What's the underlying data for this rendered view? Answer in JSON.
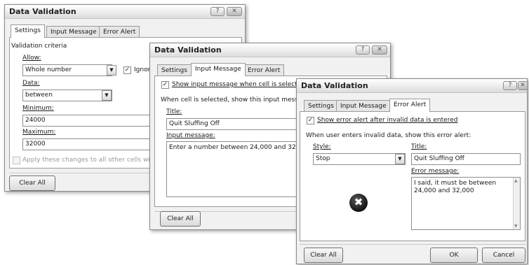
{
  "dialog1": {
    "title": "Data Validation",
    "help": "?",
    "close": "✕",
    "tabs": [
      "Settings",
      "Input Message",
      "Error Alert"
    ],
    "criteria_label": "Validation criteria",
    "allow_label": "Allow:",
    "allow_value": "Whole number",
    "ignore_blank_label": "Ignore b",
    "data_label": "Data:",
    "data_value": "between",
    "minimum_label": "Minimum:",
    "minimum_value": "24000",
    "maximum_label": "Maximum:",
    "maximum_value": "32000",
    "apply_label": "Apply these changes to all other cells with s",
    "clear_all": "Clear All"
  },
  "dialog2": {
    "title": "Data Validation",
    "help": "?",
    "close": "✕",
    "tabs": [
      "Settings",
      "Input Message",
      "Error Alert"
    ],
    "show_input_label": "Show input message when cell is selected",
    "when_selected_label": "When cell is selected, show this input message",
    "title_label": "Title:",
    "title_value": "Quit Sluffing Off",
    "input_message_label": "Input message:",
    "input_message_value": "Enter a number between 24,000 and 32,000",
    "clear_all": "Clear All"
  },
  "dialog3": {
    "title": "Data Validation",
    "help": "?",
    "close": "✕",
    "tabs": [
      "Settings",
      "Input Message",
      "Error Alert"
    ],
    "show_error_label": "Show error alert after invalid data is entered",
    "when_invalid_label": "When user enters invalid data, show this error alert:",
    "style_label": "Style:",
    "style_value": "Stop",
    "title_label": "Title:",
    "title_value": "Quit Sluffing Off",
    "error_message_label": "Error message:",
    "error_message_value": "I said, it must be between 24,000 and 32,000",
    "clear_all": "Clear All",
    "ok": "OK",
    "cancel": "Cancel"
  },
  "icons": {
    "check": "✓",
    "dropdown": "▼",
    "stop": "✖",
    "scroll_up": "▲",
    "scroll_down": "▼"
  }
}
